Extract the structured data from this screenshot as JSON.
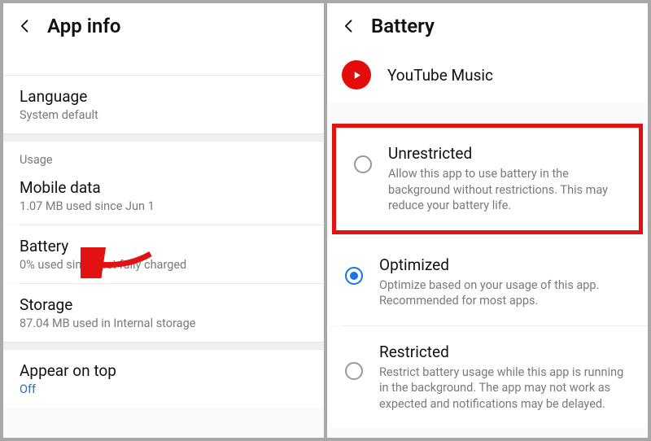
{
  "left": {
    "title": "App info",
    "language": {
      "title": "Language",
      "sub": "System default"
    },
    "usage_label": "Usage",
    "mobile_data": {
      "title": "Mobile data",
      "sub": "1.07 MB used since Jun 1"
    },
    "battery": {
      "title": "Battery",
      "sub": "0% used since last fully charged"
    },
    "storage": {
      "title": "Storage",
      "sub": "87.04 MB used in Internal storage"
    },
    "appear_on_top": {
      "title": "Appear on top",
      "sub": "Off"
    }
  },
  "right": {
    "title": "Battery",
    "app_name": "YouTube Music",
    "options": {
      "unrestricted": {
        "title": "Unrestricted",
        "desc": "Allow this app to use battery in the background without restrictions. This may reduce your battery life."
      },
      "optimized": {
        "title": "Optimized",
        "desc": "Optimize based on your usage of this app. Recommended for most apps."
      },
      "restricted": {
        "title": "Restricted",
        "desc": "Restrict battery usage while this app is running in the background. The app may not work as expected and notifications may be delayed."
      }
    }
  }
}
